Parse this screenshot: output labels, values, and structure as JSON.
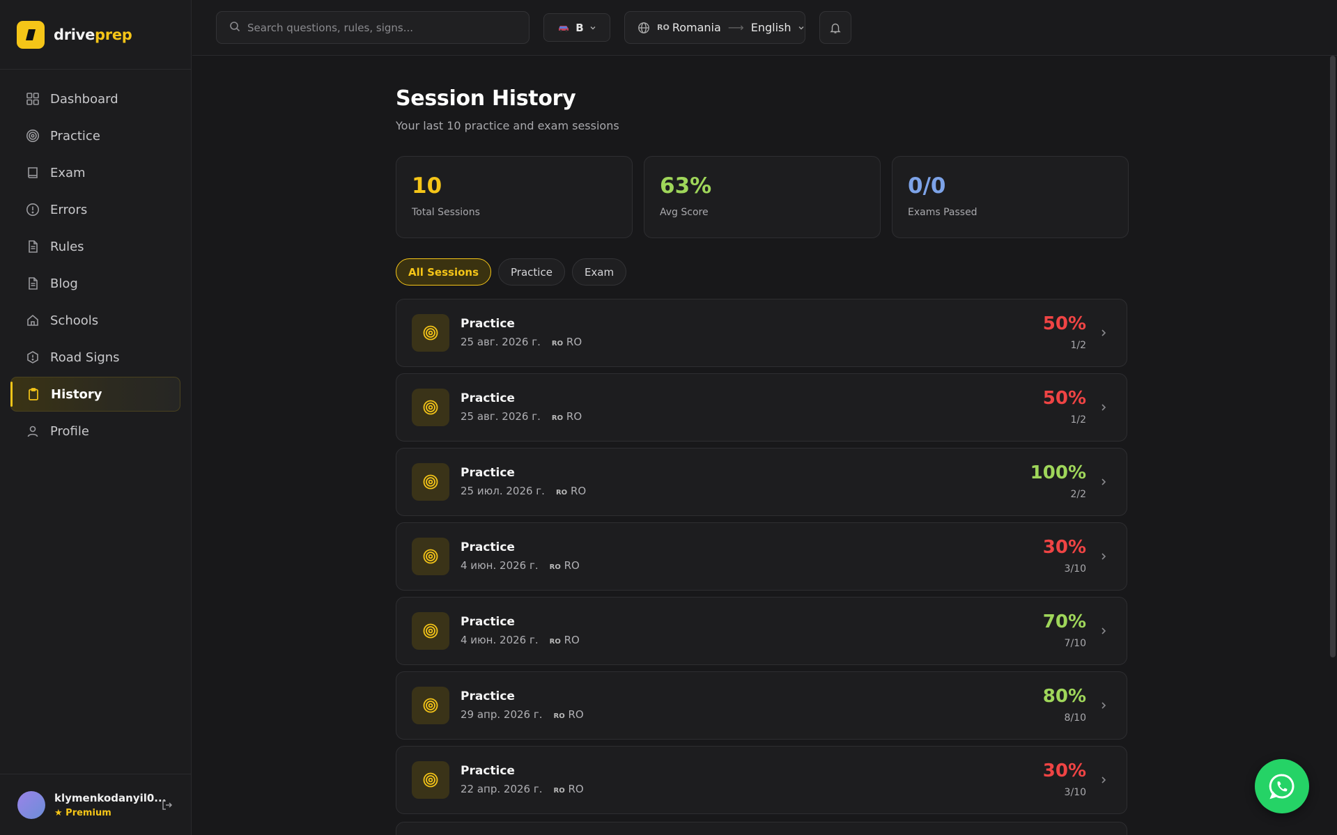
{
  "brand": {
    "name_part1": "drive",
    "name_part2": "prep"
  },
  "sidebar": {
    "items": [
      {
        "label": "Dashboard",
        "icon": "grid-icon"
      },
      {
        "label": "Practice",
        "icon": "target-icon"
      },
      {
        "label": "Exam",
        "icon": "book-icon"
      },
      {
        "label": "Errors",
        "icon": "alert-circle-icon"
      },
      {
        "label": "Rules",
        "icon": "document-icon"
      },
      {
        "label": "Blog",
        "icon": "document-icon"
      },
      {
        "label": "Schools",
        "icon": "home-icon"
      },
      {
        "label": "Road Signs",
        "icon": "octagon-alert-icon"
      },
      {
        "label": "History",
        "icon": "clipboard-icon",
        "active": true
      },
      {
        "label": "Profile",
        "icon": "user-icon"
      }
    ],
    "user": {
      "name": "klymenkodanyil0...",
      "plan": "★ Premium"
    }
  },
  "topbar": {
    "search_placeholder": "Search questions, rules, signs...",
    "category": "B",
    "country_code": "RO",
    "country": "Romania",
    "language": "English"
  },
  "page": {
    "title": "Session History",
    "subtitle": "Your last 10 practice and exam sessions"
  },
  "stats": [
    {
      "value": "10",
      "label": "Total Sessions",
      "color": "#f5c518"
    },
    {
      "value": "63%",
      "label": "Avg Score",
      "color": "#9fd65a"
    },
    {
      "value": "0/0",
      "label": "Exams Passed",
      "color": "#7da3e8"
    }
  ],
  "filters": [
    {
      "label": "All Sessions",
      "active": true
    },
    {
      "label": "Practice"
    },
    {
      "label": "Exam"
    }
  ],
  "sessions": [
    {
      "title": "Practice",
      "date": "25 авг. 2026 г.",
      "code": "RO",
      "region": "RO",
      "score": "50%",
      "fraction": "1/2",
      "score_color": "#ef4444"
    },
    {
      "title": "Practice",
      "date": "25 авг. 2026 г.",
      "code": "RO",
      "region": "RO",
      "score": "50%",
      "fraction": "1/2",
      "score_color": "#ef4444"
    },
    {
      "title": "Practice",
      "date": "25 июл. 2026 г.",
      "code": "RO",
      "region": "RO",
      "score": "100%",
      "fraction": "2/2",
      "score_color": "#9fd65a"
    },
    {
      "title": "Practice",
      "date": "4 июн. 2026 г.",
      "code": "RO",
      "region": "RO",
      "score": "30%",
      "fraction": "3/10",
      "score_color": "#ef4444"
    },
    {
      "title": "Practice",
      "date": "4 июн. 2026 г.",
      "code": "RO",
      "region": "RO",
      "score": "70%",
      "fraction": "7/10",
      "score_color": "#9fd65a"
    },
    {
      "title": "Practice",
      "date": "29 апр. 2026 г.",
      "code": "RO",
      "region": "RO",
      "score": "80%",
      "fraction": "8/10",
      "score_color": "#9fd65a"
    },
    {
      "title": "Practice",
      "date": "22 апр. 2026 г.",
      "code": "RO",
      "region": "RO",
      "score": "30%",
      "fraction": "3/10",
      "score_color": "#ef4444"
    }
  ],
  "colors": {
    "accent": "#f5c518",
    "whatsapp": "#25d366"
  }
}
